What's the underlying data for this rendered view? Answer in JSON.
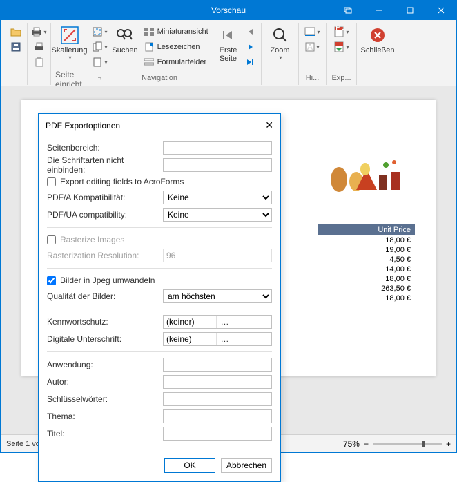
{
  "titlebar": {
    "title": "Vorschau"
  },
  "ribbon": {
    "page_setup_label": "Seite einricht...",
    "scale_label": "Skalierung",
    "search_label": "Suchen",
    "thumbnails_label": "Miniaturansicht",
    "bookmarks_label": "Lesezeichen",
    "formfields_label": "Formularfelder",
    "nav_group_label": "Navigation",
    "first_page_label": "Erste Seite",
    "zoom_label": "Zoom",
    "highlight_label": "Hi...",
    "export_label": "Exp...",
    "close_label": "Schließen"
  },
  "document": {
    "unit_price_header": "Unit Price",
    "prices": [
      "18,00 €",
      "19,00 €",
      "4,50 €",
      "14,00 €",
      "18,00 €",
      "263,50 €",
      "18,00 €"
    ]
  },
  "statusbar": {
    "page": "Seite 1 vo",
    "zoom": "75%",
    "minus": "−",
    "plus": "+"
  },
  "dialog": {
    "title": "PDF Exportoptionen",
    "labels": {
      "page_range": "Seitenbereich:",
      "no_embed_fonts": "Die Schriftarten nicht einbinden:",
      "export_acroforms": "Export editing fields to AcroForms",
      "pdfa": "PDF/A Kompatibilität:",
      "pdfua": "PDF/UA compatibility:",
      "rasterize": "Rasterize Images",
      "raster_res": "Rasterization Resolution:",
      "convert_jpeg": "Bilder in Jpeg umwandeln",
      "image_quality": "Qualität der Bilder:",
      "password": "Kennwortschutz:",
      "signature": "Digitale Unterschrift:",
      "application": "Anwendung:",
      "author": "Autor:",
      "keywords": "Schlüsselwörter:",
      "subject": "Thema:",
      "title": "Titel:"
    },
    "values": {
      "pdfa": "Keine",
      "pdfua": "Keine",
      "raster_res": "96",
      "image_quality": "am höchsten",
      "password": "(keiner)",
      "signature": "(keine)"
    },
    "buttons": {
      "ok": "OK",
      "cancel": "Abbrechen"
    }
  }
}
